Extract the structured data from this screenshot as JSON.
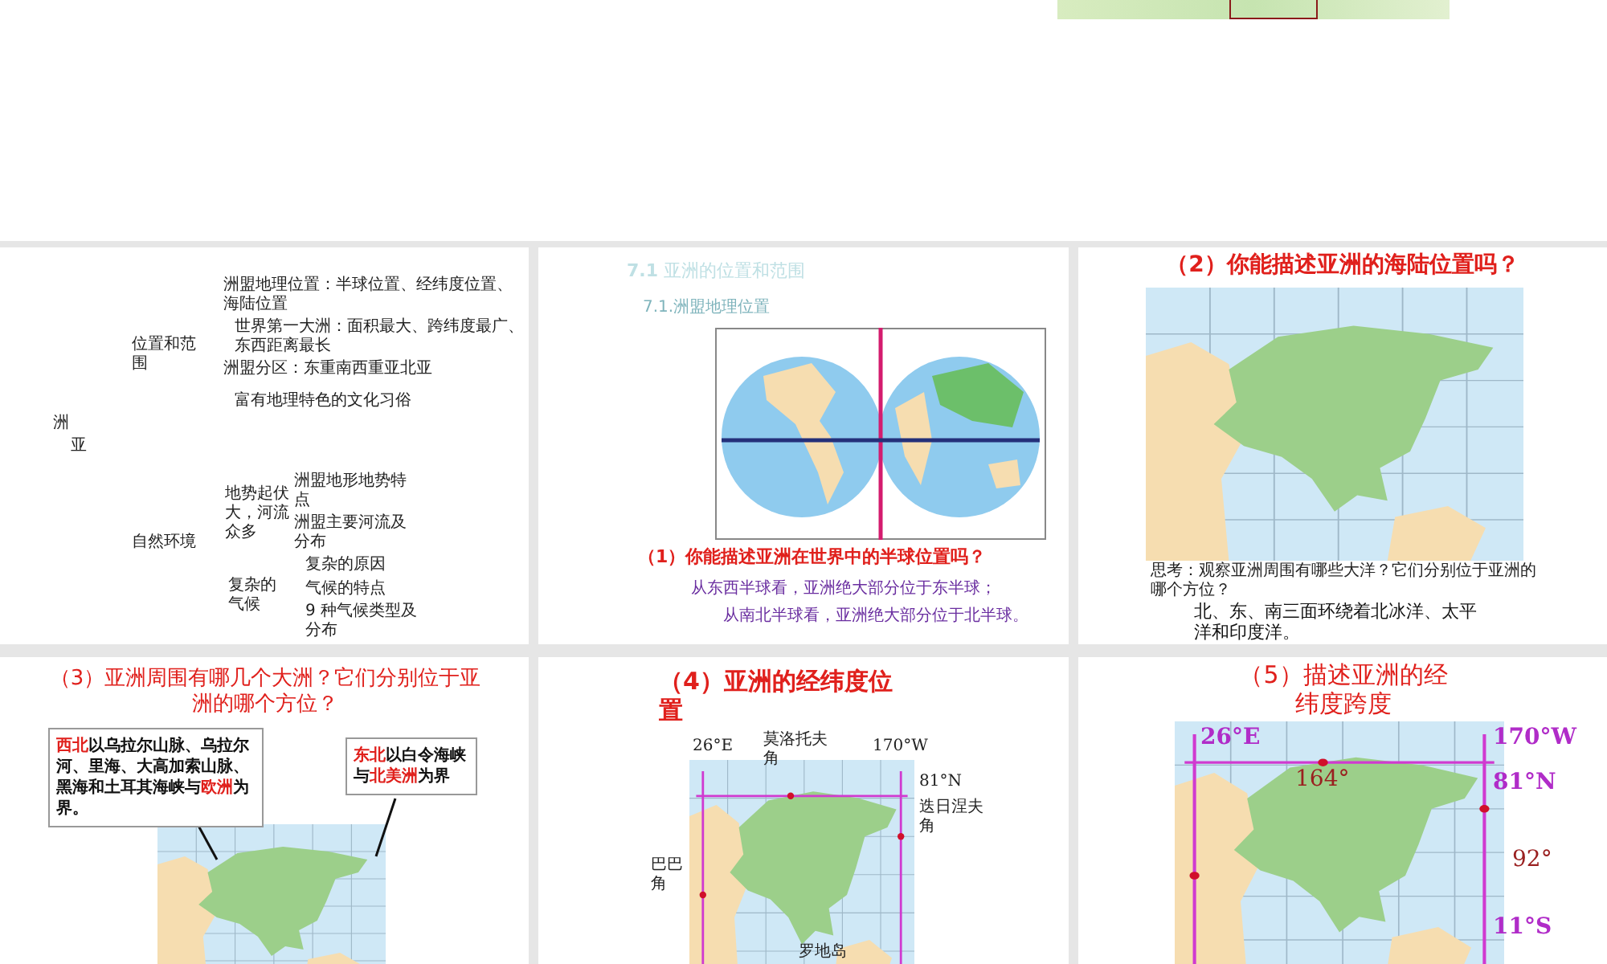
{
  "slides": [
    {
      "kind": "outline",
      "texts": [
        "洲",
        "亚",
        "位置和范围",
        "洲盟地理位置：半球位置、经纬度位置、海陆位置",
        "世界第一大洲：面积最大、跨纬度最广、东西距离最长",
        "洲盟分区：东重南西重亚北亚",
        "富有地理特色的文化习俗",
        "自然环境",
        "地势起伏大，河流众多",
        "洲盟地形地势特点",
        "洲盟主要河流及分布",
        "复杂的原因",
        "复杂的气候",
        "气候的特点",
        "9 种气候类型及分布"
      ]
    },
    {
      "kind": "hemispheres",
      "title": "**7.1** 亚洲的位置和范围",
      "subtitle": "7.1.洲盟地理位置",
      "question": "（1）你能描述亚洲在世界中的半球位置吗？",
      "answers": [
        "从东西半球看，亚洲绝大部分位于东半球；",
        "从南北半球看，亚洲绝大部分位于北半球。"
      ]
    },
    {
      "kind": "sea_land",
      "title": "（2）你能描述亚洲的海陆位置吗？",
      "prompt": "思考：观察亚洲周围有哪些大洋？它们分别位于亚洲的哪个方位？",
      "answer": "北、东、南三面环绕着北冰洋、太平洋和印度洋。"
    },
    {
      "kind": "neighbors",
      "title": "（3）亚洲周围有哪几个大洲？它们分别位于亚洲的哪个方位？",
      "callouts": [
        "**西北**以乌拉尔山脉、乌拉尔河、里海、大高加索山脉、黑海和土耳其海峡与**欧洲**为界。",
        "**东北**以白令海峡与**北美洲**为界"
      ]
    },
    {
      "kind": "coordinates",
      "title": "（4）亚洲的经纬度位置",
      "labels": [
        "26°E",
        "莫洛托夫角",
        "170°W",
        "81°N",
        "迭日涅夫角",
        "巴巴角",
        "罗地岛"
      ]
    },
    {
      "kind": "span",
      "title": "（5）描述亚洲的经纬度跨度",
      "labels": [
        "26°E",
        "170°W",
        "164°",
        "81°N",
        "92°",
        "11°S"
      ]
    }
  ]
}
